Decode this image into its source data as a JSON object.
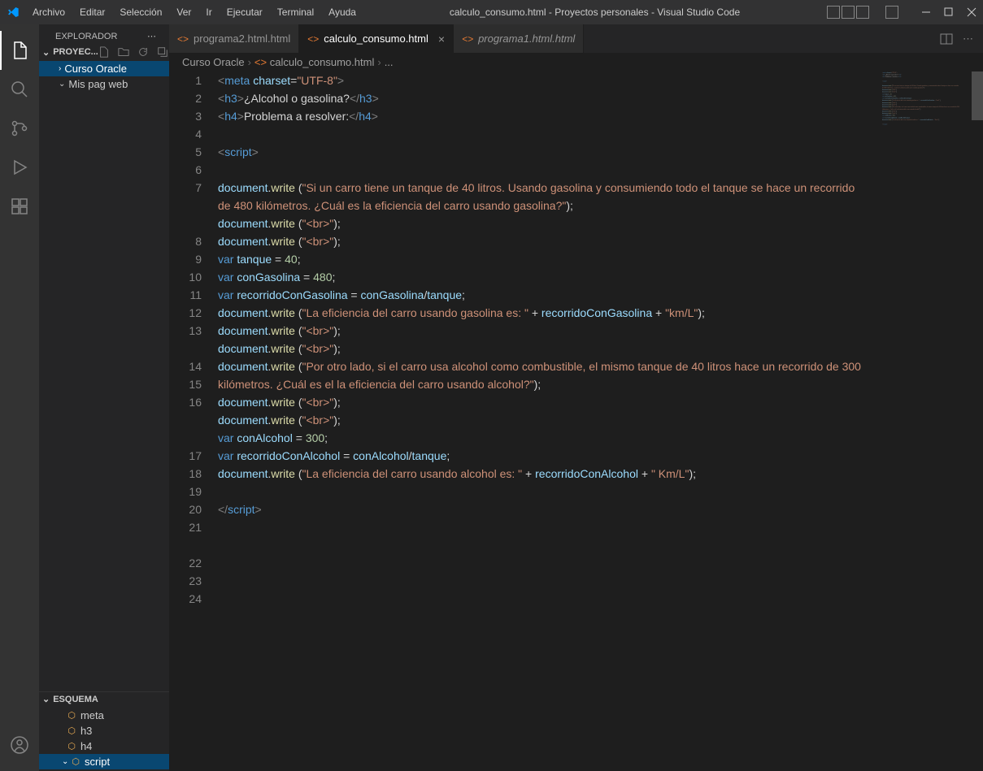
{
  "menu": [
    "Archivo",
    "Editar",
    "Selección",
    "Ver",
    "Ir",
    "Ejecutar",
    "Terminal",
    "Ayuda"
  ],
  "title": "calculo_consumo.html - Proyectos personales - Visual Studio Code",
  "sidebar": {
    "title": "EXPLORADOR",
    "section": "PROYEC...",
    "folders": [
      {
        "label": "Curso Oracle",
        "expanded": true,
        "selected": true
      },
      {
        "label": "Mis pag web",
        "expanded": false,
        "selected": false
      }
    ],
    "outlineTitle": "ESQUEMA",
    "outline": [
      {
        "label": "meta",
        "nested": 0
      },
      {
        "label": "h3",
        "nested": 0
      },
      {
        "label": "h4",
        "nested": 0
      },
      {
        "label": "script",
        "nested": 0,
        "expanded": true,
        "active": true
      }
    ]
  },
  "tabs": [
    {
      "label": "programa2.html.html",
      "active": false,
      "italic": false
    },
    {
      "label": "calculo_consumo.html",
      "active": true,
      "italic": false
    },
    {
      "label": "programa1.html.html",
      "active": false,
      "italic": true
    }
  ],
  "breadcrumb": [
    "Curso Oracle",
    "calculo_consumo.html",
    "..."
  ],
  "code": {
    "lines": [
      {
        "n": 1,
        "seg": [
          [
            "t-tag",
            "<"
          ],
          [
            "t-name",
            "meta"
          ],
          [
            "t-text",
            " "
          ],
          [
            "t-attr",
            "charset"
          ],
          [
            "t-punc",
            "="
          ],
          [
            "t-str",
            "\"UTF-8\""
          ],
          [
            "t-tag",
            ">"
          ]
        ]
      },
      {
        "n": 2,
        "seg": [
          [
            "t-tag",
            "<"
          ],
          [
            "t-name",
            "h3"
          ],
          [
            "t-tag",
            ">"
          ],
          [
            "t-text",
            "¿Alcohol o gasolina?"
          ],
          [
            "t-tag",
            "</"
          ],
          [
            "t-name",
            "h3"
          ],
          [
            "t-tag",
            ">"
          ]
        ]
      },
      {
        "n": 3,
        "seg": [
          [
            "t-tag",
            "<"
          ],
          [
            "t-name",
            "h4"
          ],
          [
            "t-tag",
            ">"
          ],
          [
            "t-text",
            "Problema a resolver:"
          ],
          [
            "t-tag",
            "</"
          ],
          [
            "t-name",
            "h4"
          ],
          [
            "t-tag",
            ">"
          ]
        ]
      },
      {
        "n": 4,
        "seg": []
      },
      {
        "n": 5,
        "seg": [
          [
            "t-tag",
            "<"
          ],
          [
            "t-name",
            "script"
          ],
          [
            "t-tag",
            ">"
          ]
        ]
      },
      {
        "n": 6,
        "seg": []
      },
      {
        "n": 7,
        "seg": [
          [
            "t-obj",
            "document"
          ],
          [
            "t-punc",
            "."
          ],
          [
            "t-fn",
            "write"
          ],
          [
            "t-punc",
            " ("
          ],
          [
            "t-str",
            "\"Si un carro tiene un tanque de 40 litros. Usando gasolina y consumiendo todo el tanque se hace un recorrido de 480 kilómetros. ¿Cuál es la eficiencia del carro usando gasolina?\""
          ],
          [
            "t-punc",
            ");"
          ]
        ]
      },
      {
        "n": 8,
        "seg": [
          [
            "t-obj",
            "document"
          ],
          [
            "t-punc",
            "."
          ],
          [
            "t-fn",
            "write"
          ],
          [
            "t-punc",
            " ("
          ],
          [
            "t-str",
            "\"<br>\""
          ],
          [
            "t-punc",
            ");"
          ]
        ]
      },
      {
        "n": 9,
        "seg": [
          [
            "t-obj",
            "document"
          ],
          [
            "t-punc",
            "."
          ],
          [
            "t-fn",
            "write"
          ],
          [
            "t-punc",
            " ("
          ],
          [
            "t-str",
            "\"<br>\""
          ],
          [
            "t-punc",
            ");"
          ]
        ]
      },
      {
        "n": 10,
        "seg": [
          [
            "t-kw",
            "var"
          ],
          [
            "t-text",
            " "
          ],
          [
            "t-var",
            "tanque"
          ],
          [
            "t-punc",
            " = "
          ],
          [
            "t-num",
            "40"
          ],
          [
            "t-punc",
            ";"
          ]
        ]
      },
      {
        "n": 11,
        "seg": [
          [
            "t-kw",
            "var"
          ],
          [
            "t-text",
            " "
          ],
          [
            "t-var",
            "conGasolina"
          ],
          [
            "t-punc",
            " = "
          ],
          [
            "t-num",
            "480"
          ],
          [
            "t-punc",
            ";"
          ]
        ]
      },
      {
        "n": 12,
        "seg": [
          [
            "t-kw",
            "var"
          ],
          [
            "t-text",
            " "
          ],
          [
            "t-var",
            "recorridoConGasolina"
          ],
          [
            "t-punc",
            " = "
          ],
          [
            "t-var",
            "conGasolina"
          ],
          [
            "t-punc",
            "/"
          ],
          [
            "t-var",
            "tanque"
          ],
          [
            "t-punc",
            ";"
          ]
        ]
      },
      {
        "n": 13,
        "seg": [
          [
            "t-obj",
            "document"
          ],
          [
            "t-punc",
            "."
          ],
          [
            "t-fn",
            "write"
          ],
          [
            "t-punc",
            " ("
          ],
          [
            "t-str",
            "\"La eficiencia del carro usando gasolina es: \""
          ],
          [
            "t-punc",
            " + "
          ],
          [
            "t-var",
            "recorridoConGasolina"
          ],
          [
            "t-punc",
            " + "
          ],
          [
            "t-str",
            "\"km/L\""
          ],
          [
            "t-punc",
            ");"
          ]
        ]
      },
      {
        "n": 14,
        "seg": [
          [
            "t-obj",
            "document"
          ],
          [
            "t-punc",
            "."
          ],
          [
            "t-fn",
            "write"
          ],
          [
            "t-punc",
            " ("
          ],
          [
            "t-str",
            "\"<br>\""
          ],
          [
            "t-punc",
            ");"
          ]
        ]
      },
      {
        "n": 15,
        "seg": [
          [
            "t-obj",
            "document"
          ],
          [
            "t-punc",
            "."
          ],
          [
            "t-fn",
            "write"
          ],
          [
            "t-punc",
            " ("
          ],
          [
            "t-str",
            "\"<br>\""
          ],
          [
            "t-punc",
            ");"
          ]
        ]
      },
      {
        "n": 16,
        "seg": [
          [
            "t-obj",
            "document"
          ],
          [
            "t-punc",
            "."
          ],
          [
            "t-fn",
            "write"
          ],
          [
            "t-punc",
            " ("
          ],
          [
            "t-str",
            "\"Por otro lado, si el carro usa alcohol como combustible, el mismo tanque de 40 litros hace un recorrido de 300 kilómetros. ¿Cuál es el la eficiencia del carro usando alcohol?\""
          ],
          [
            "t-punc",
            ");"
          ]
        ]
      },
      {
        "n": 17,
        "seg": [
          [
            "t-obj",
            "document"
          ],
          [
            "t-punc",
            "."
          ],
          [
            "t-fn",
            "write"
          ],
          [
            "t-punc",
            " ("
          ],
          [
            "t-str",
            "\"<br>\""
          ],
          [
            "t-punc",
            ");"
          ]
        ]
      },
      {
        "n": 18,
        "seg": [
          [
            "t-obj",
            "document"
          ],
          [
            "t-punc",
            "."
          ],
          [
            "t-fn",
            "write"
          ],
          [
            "t-punc",
            " ("
          ],
          [
            "t-str",
            "\"<br>\""
          ],
          [
            "t-punc",
            ");"
          ]
        ]
      },
      {
        "n": 19,
        "seg": [
          [
            "t-kw",
            "var"
          ],
          [
            "t-text",
            " "
          ],
          [
            "t-var",
            "conAlcohol"
          ],
          [
            "t-punc",
            " = "
          ],
          [
            "t-num",
            "300"
          ],
          [
            "t-punc",
            ";"
          ]
        ]
      },
      {
        "n": 20,
        "seg": [
          [
            "t-kw",
            "var"
          ],
          [
            "t-text",
            " "
          ],
          [
            "t-var",
            "recorridoConAlcohol"
          ],
          [
            "t-punc",
            " = "
          ],
          [
            "t-var",
            "conAlcohol"
          ],
          [
            "t-punc",
            "/"
          ],
          [
            "t-var",
            "tanque"
          ],
          [
            "t-punc",
            ";"
          ]
        ]
      },
      {
        "n": 21,
        "seg": [
          [
            "t-obj",
            "document"
          ],
          [
            "t-punc",
            "."
          ],
          [
            "t-fn",
            "write"
          ],
          [
            "t-punc",
            " ("
          ],
          [
            "t-str",
            "\"La eficiencia del carro usando alcohol es: \""
          ],
          [
            "t-punc",
            " + "
          ],
          [
            "t-var",
            "recorridoConAlcohol"
          ],
          [
            "t-punc",
            " + "
          ],
          [
            "t-str",
            "\" Km/L\""
          ],
          [
            "t-punc",
            ");"
          ]
        ]
      },
      {
        "n": 22,
        "seg": []
      },
      {
        "n": 23,
        "seg": [
          [
            "t-tag",
            "</"
          ],
          [
            "t-name",
            "script"
          ],
          [
            "t-tag",
            ">"
          ]
        ]
      },
      {
        "n": 24,
        "seg": []
      }
    ]
  }
}
